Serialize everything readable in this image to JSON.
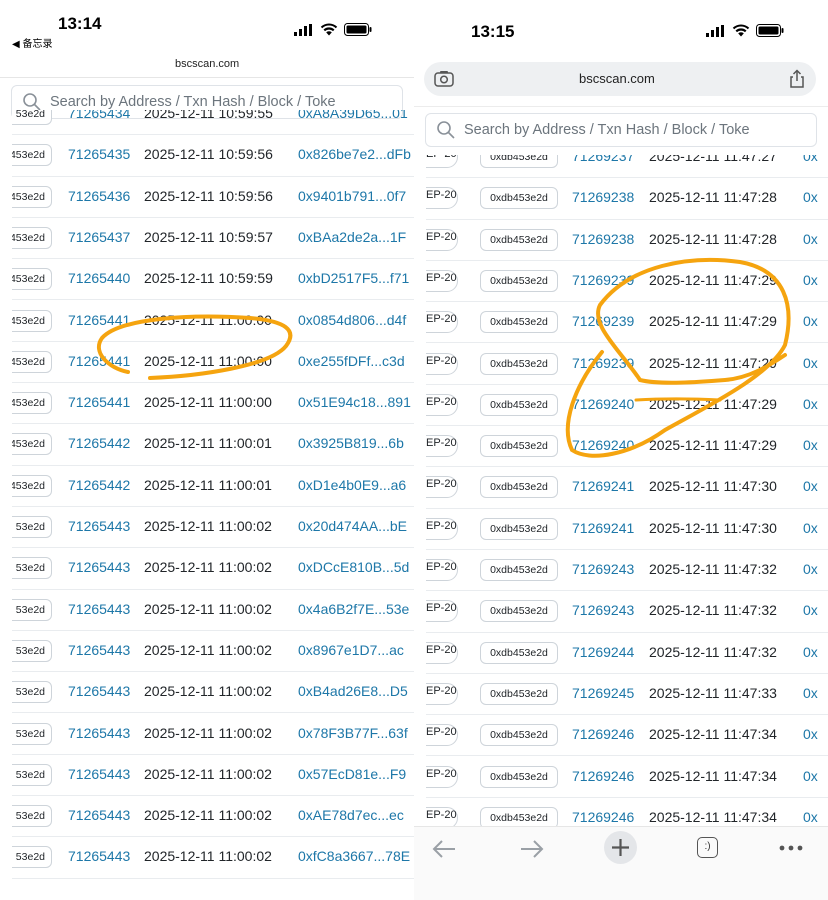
{
  "left": {
    "status_time": "13:14",
    "back_label": "◀ 备忘录",
    "url": "bscscan.com",
    "search_placeholder": "Search by Address / Txn Hash / Block / Toke",
    "rows": [
      {
        "badge": "53e2d",
        "block": "71265434",
        "time": "2025-12-11 10:59:55",
        "hash": "0xA8A39D65...01"
      },
      {
        "badge": "453e2d",
        "block": "71265435",
        "time": "2025-12-11 10:59:56",
        "hash": "0x826be7e2...dFb"
      },
      {
        "badge": "453e2d",
        "block": "71265436",
        "time": "2025-12-11 10:59:56",
        "hash": "0x9401b791...0f7"
      },
      {
        "badge": "453e2d",
        "block": "71265437",
        "time": "2025-12-11 10:59:57",
        "hash": "0xBAa2de2a...1F"
      },
      {
        "badge": "453e2d",
        "block": "71265440",
        "time": "2025-12-11 10:59:59",
        "hash": "0xbD2517F5...f71"
      },
      {
        "badge": "453e2d",
        "block": "71265441",
        "time": "2025-12-11 11:00:00",
        "hash": "0x0854d806...d4f"
      },
      {
        "badge": "453e2d",
        "block": "71265441",
        "time": "2025-12-11 11:00:00",
        "hash": "0xe255fDFf...c3d"
      },
      {
        "badge": "453e2d",
        "block": "71265441",
        "time": "2025-12-11 11:00:00",
        "hash": "0x51E94c18...891"
      },
      {
        "badge": "453e2d",
        "block": "71265442",
        "time": "2025-12-11 11:00:01",
        "hash": "0x3925B819...6b"
      },
      {
        "badge": "453e2d",
        "block": "71265442",
        "time": "2025-12-11 11:00:01",
        "hash": "0xD1e4b0E9...a6"
      },
      {
        "badge": "53e2d",
        "block": "71265443",
        "time": "2025-12-11 11:00:02",
        "hash": "0x20d474AA...bE"
      },
      {
        "badge": "53e2d",
        "block": "71265443",
        "time": "2025-12-11 11:00:02",
        "hash": "0xDCcE810B...5d"
      },
      {
        "badge": "53e2d",
        "block": "71265443",
        "time": "2025-12-11 11:00:02",
        "hash": "0x4a6B2f7E...53e"
      },
      {
        "badge": "53e2d",
        "block": "71265443",
        "time": "2025-12-11 11:00:02",
        "hash": "0x8967e1D7...ac"
      },
      {
        "badge": "53e2d",
        "block": "71265443",
        "time": "2025-12-11 11:00:02",
        "hash": "0xB4ad26E8...D5"
      },
      {
        "badge": "53e2d",
        "block": "71265443",
        "time": "2025-12-11 11:00:02",
        "hash": "0x78F3B77F...63f"
      },
      {
        "badge": "53e2d",
        "block": "71265443",
        "time": "2025-12-11 11:00:02",
        "hash": "0x57EcD81e...F9"
      },
      {
        "badge": "53e2d",
        "block": "71265443",
        "time": "2025-12-11 11:00:02",
        "hash": "0xAE78d7ec...ec"
      },
      {
        "badge": "53e2d",
        "block": "71265443",
        "time": "2025-12-11 11:00:02",
        "hash": "0xfC8a3667...78E"
      }
    ]
  },
  "right": {
    "status_time": "13:15",
    "url": "bscscan.com",
    "search_placeholder": "Search by Address / Txn Hash / Block / Toke",
    "rows": [
      {
        "type": "EP-20",
        "badge": "0xdb453e2d",
        "block": "71269237",
        "time": "2025-12-11 11:47:27",
        "hash": "0x"
      },
      {
        "type": "EP-20",
        "badge": "0xdb453e2d",
        "block": "71269238",
        "time": "2025-12-11 11:47:28",
        "hash": "0x"
      },
      {
        "type": "EP-20",
        "badge": "0xdb453e2d",
        "block": "71269238",
        "time": "2025-12-11 11:47:28",
        "hash": "0x"
      },
      {
        "type": "EP-20",
        "badge": "0xdb453e2d",
        "block": "71269239",
        "time": "2025-12-11 11:47:29",
        "hash": "0x"
      },
      {
        "type": "EP-20",
        "badge": "0xdb453e2d",
        "block": "71269239",
        "time": "2025-12-11 11:47:29",
        "hash": "0x"
      },
      {
        "type": "EP-20",
        "badge": "0xdb453e2d",
        "block": "71269239",
        "time": "2025-12-11 11:47:29",
        "hash": "0x"
      },
      {
        "type": "EP-20",
        "badge": "0xdb453e2d",
        "block": "71269240",
        "time": "2025-12-11 11:47:29",
        "hash": "0x"
      },
      {
        "type": "EP-20",
        "badge": "0xdb453e2d",
        "block": "71269240",
        "time": "2025-12-11 11:47:29",
        "hash": "0x"
      },
      {
        "type": "EP-20",
        "badge": "0xdb453e2d",
        "block": "71269241",
        "time": "2025-12-11 11:47:30",
        "hash": "0x"
      },
      {
        "type": "EP-20",
        "badge": "0xdb453e2d",
        "block": "71269241",
        "time": "2025-12-11 11:47:30",
        "hash": "0x"
      },
      {
        "type": "EP-20",
        "badge": "0xdb453e2d",
        "block": "71269243",
        "time": "2025-12-11 11:47:32",
        "hash": "0x"
      },
      {
        "type": "EP-20",
        "badge": "0xdb453e2d",
        "block": "71269243",
        "time": "2025-12-11 11:47:32",
        "hash": "0x"
      },
      {
        "type": "EP-20",
        "badge": "0xdb453e2d",
        "block": "71269244",
        "time": "2025-12-11 11:47:32",
        "hash": "0x"
      },
      {
        "type": "EP-20",
        "badge": "0xdb453e2d",
        "block": "71269245",
        "time": "2025-12-11 11:47:33",
        "hash": "0x"
      },
      {
        "type": "EP-20",
        "badge": "0xdb453e2d",
        "block": "71269246",
        "time": "2025-12-11 11:47:34",
        "hash": "0x"
      },
      {
        "type": "EP-20",
        "badge": "0xdb453e2d",
        "block": "71269246",
        "time": "2025-12-11 11:47:34",
        "hash": "0x"
      },
      {
        "type": "EP-20",
        "badge": "0xdb453e2d",
        "block": "71269246",
        "time": "2025-12-11 11:47:34",
        "hash": "0x"
      }
    ],
    "toolbar": {
      "back_icon": "arrow-left-icon",
      "forward_icon": "arrow-right-icon",
      "new_tab_icon": "plus-icon",
      "tabs_label": ":)",
      "more_icon": "more-dots-icon"
    }
  },
  "colors": {
    "link": "#1d77a8",
    "annotation": "#f5a40f",
    "border": "#e9ecef"
  }
}
